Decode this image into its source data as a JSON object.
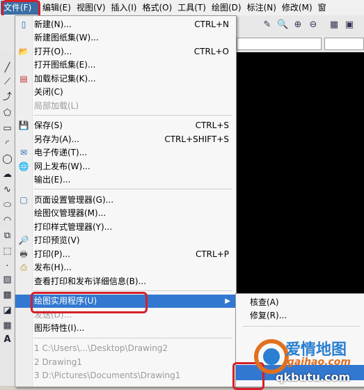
{
  "menubar": {
    "items": [
      {
        "label": "文件(F)"
      },
      {
        "label": "编辑(E)"
      },
      {
        "label": "视图(V)"
      },
      {
        "label": "插入(I)"
      },
      {
        "label": "格式(O)"
      },
      {
        "label": "工具(T)"
      },
      {
        "label": "绘图(D)"
      },
      {
        "label": "标注(N)"
      },
      {
        "label": "修改(M)"
      },
      {
        "label": "窗"
      }
    ]
  },
  "file_menu": {
    "items": [
      {
        "label": "新建(N)...",
        "shortcut": "CTRL+N"
      },
      {
        "label": "新建图纸集(W)..."
      },
      {
        "label": "打开(O)...",
        "shortcut": "CTRL+O"
      },
      {
        "label": "打开图纸集(E)..."
      },
      {
        "label": "加载标记集(K)..."
      },
      {
        "label": "关闭(C)"
      },
      {
        "label": "局部加载(L)"
      },
      {
        "label": "保存(S)",
        "shortcut": "CTRL+S"
      },
      {
        "label": "另存为(A)...",
        "shortcut": "CTRL+SHIFT+S"
      },
      {
        "label": "电子传递(T)..."
      },
      {
        "label": "网上发布(W)..."
      },
      {
        "label": "输出(E)..."
      },
      {
        "label": "页面设置管理器(G)..."
      },
      {
        "label": "绘图仪管理器(M)..."
      },
      {
        "label": "打印样式管理器(Y)..."
      },
      {
        "label": "打印预览(V)"
      },
      {
        "label": "打印(P)...",
        "shortcut": "CTRL+P"
      },
      {
        "label": "发布(H)..."
      },
      {
        "label": "查看打印和发布详细信息(B)..."
      },
      {
        "label": "绘图实用程序(U)"
      },
      {
        "label": "发送(D)..."
      },
      {
        "label": "图形特性(I)..."
      },
      {
        "label": "1 C:\\Users\\...\\Desktop\\Drawing2"
      },
      {
        "label": "2 Drawing1"
      },
      {
        "label": "3 D:\\Pictures\\Documents\\Drawing1"
      }
    ]
  },
  "submenu": {
    "items": [
      {
        "label": "核查(A)"
      },
      {
        "label": "修复(R)..."
      }
    ]
  },
  "watermark": {
    "line1": "爱情地图",
    "line2": "igaihao.com",
    "line3": "qkbutu.com"
  },
  "colors": {
    "highlight_box": "#d4202a",
    "menu_hover": "#3278d0"
  }
}
